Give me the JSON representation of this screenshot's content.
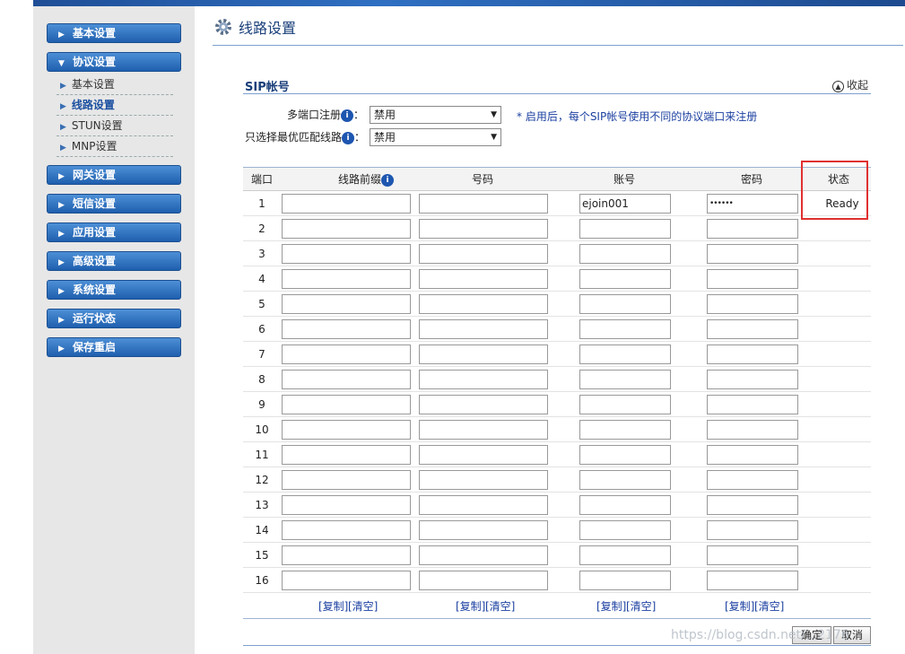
{
  "sidebar": {
    "menu": [
      "基本设置",
      "协议设置",
      "网关设置",
      "短信设置",
      "应用设置",
      "高级设置",
      "系统设置",
      "运行状态",
      "保存重启"
    ],
    "submenu": [
      "基本设置",
      "线路设置",
      "STUN设置",
      "MNP设置"
    ],
    "active_submenu": "线路设置"
  },
  "page": {
    "title": "线路设置",
    "section_title": "SIP帐号",
    "collapse_label": "收起"
  },
  "options": {
    "multi_port_label": "多端口注册",
    "multi_port_value": "禁用",
    "best_match_label": "只选择最优匹配线路",
    "best_match_value": "禁用",
    "colon": "：",
    "note": "* 启用后，每个SIP帐号使用不同的协议端口来注册"
  },
  "table": {
    "headers": [
      "端口",
      "线路前缀",
      "号码",
      "账号",
      "密码",
      "状态"
    ],
    "rows": [
      {
        "port": "1",
        "prefix": "",
        "number": "",
        "account": "ejoin001",
        "password": "••••••",
        "status": "Ready"
      },
      {
        "port": "2",
        "prefix": "",
        "number": "",
        "account": "",
        "password": "",
        "status": ""
      },
      {
        "port": "3",
        "prefix": "",
        "number": "",
        "account": "",
        "password": "",
        "status": ""
      },
      {
        "port": "4",
        "prefix": "",
        "number": "",
        "account": "",
        "password": "",
        "status": ""
      },
      {
        "port": "5",
        "prefix": "",
        "number": "",
        "account": "",
        "password": "",
        "status": ""
      },
      {
        "port": "6",
        "prefix": "",
        "number": "",
        "account": "",
        "password": "",
        "status": ""
      },
      {
        "port": "7",
        "prefix": "",
        "number": "",
        "account": "",
        "password": "",
        "status": ""
      },
      {
        "port": "8",
        "prefix": "",
        "number": "",
        "account": "",
        "password": "",
        "status": ""
      },
      {
        "port": "9",
        "prefix": "",
        "number": "",
        "account": "",
        "password": "",
        "status": ""
      },
      {
        "port": "10",
        "prefix": "",
        "number": "",
        "account": "",
        "password": "",
        "status": ""
      },
      {
        "port": "11",
        "prefix": "",
        "number": "",
        "account": "",
        "password": "",
        "status": ""
      },
      {
        "port": "12",
        "prefix": "",
        "number": "",
        "account": "",
        "password": "",
        "status": ""
      },
      {
        "port": "13",
        "prefix": "",
        "number": "",
        "account": "",
        "password": "",
        "status": ""
      },
      {
        "port": "14",
        "prefix": "",
        "number": "",
        "account": "",
        "password": "",
        "status": ""
      },
      {
        "port": "15",
        "prefix": "",
        "number": "",
        "account": "",
        "password": "",
        "status": ""
      },
      {
        "port": "16",
        "prefix": "",
        "number": "",
        "account": "",
        "password": "",
        "status": ""
      }
    ],
    "copy_label": "[复制]",
    "clear_label": "[清空]"
  },
  "buttons": {
    "confirm": "确定",
    "cancel": "取消"
  },
  "watermark": "https://blog.csdn.net/...2176",
  "colors": {
    "nav_button": "#2f6fc2",
    "highlight_box": "#e03030",
    "link": "#1a3fa0"
  }
}
